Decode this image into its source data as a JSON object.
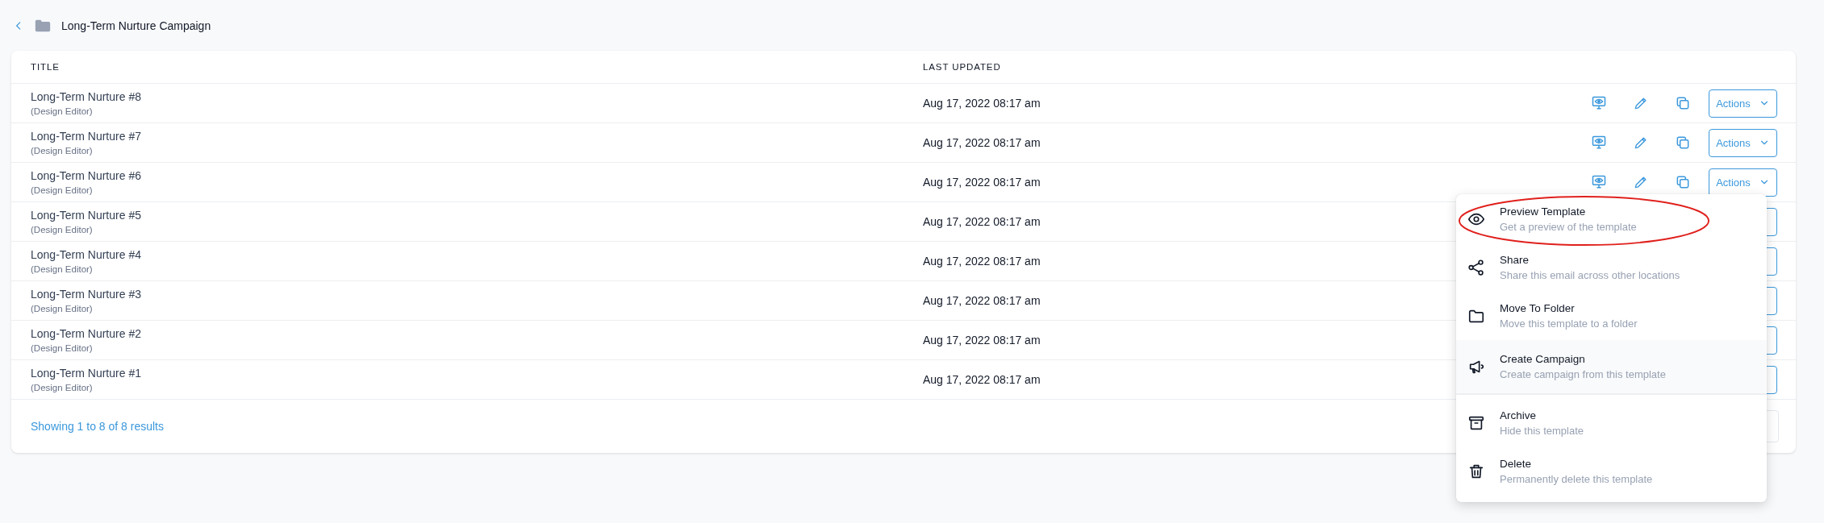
{
  "breadcrumb": {
    "title": "Long-Term Nurture Campaign"
  },
  "table": {
    "columns": [
      "TITLE",
      "LAST UPDATED"
    ],
    "rows": [
      {
        "title": "Long-Term Nurture #8",
        "subtitle": "(Design Editor)",
        "updated": "Aug 17, 2022 08:17 am",
        "actions_label": "Actions",
        "menu_open": false
      },
      {
        "title": "Long-Term Nurture #7",
        "subtitle": "(Design Editor)",
        "updated": "Aug 17, 2022 08:17 am",
        "actions_label": "Actions",
        "menu_open": false
      },
      {
        "title": "Long-Term Nurture #6",
        "subtitle": "(Design Editor)",
        "updated": "Aug 17, 2022 08:17 am",
        "actions_label": "Actions",
        "menu_open": true
      },
      {
        "title": "Long-Term Nurture #5",
        "subtitle": "(Design Editor)",
        "updated": "Aug 17, 2022 08:17 am",
        "menu_open": false
      },
      {
        "title": "Long-Term Nurture #4",
        "subtitle": "(Design Editor)",
        "updated": "Aug 17, 2022 08:17 am",
        "menu_open": false
      },
      {
        "title": "Long-Term Nurture #3",
        "subtitle": "(Design Editor)",
        "updated": "Aug 17, 2022 08:17 am",
        "menu_open": false
      },
      {
        "title": "Long-Term Nurture #2",
        "subtitle": "(Design Editor)",
        "updated": "Aug 17, 2022 08:17 am",
        "menu_open": false
      },
      {
        "title": "Long-Term Nurture #1",
        "subtitle": "(Design Editor)",
        "updated": "Aug 17, 2022 08:17 am",
        "menu_open": false
      }
    ],
    "footer": "Showing 1 to 8 of 8 results"
  },
  "actions_menu": {
    "items": [
      {
        "kind": "eye",
        "label": "Preview Template",
        "description": "Get a preview of the template",
        "hovered": false,
        "circled": true
      },
      {
        "kind": "share",
        "label": "Share",
        "description": "Share this email across other locations",
        "hovered": false,
        "circled": false
      },
      {
        "kind": "folder",
        "label": "Move To Folder",
        "description": "Move this template to a folder",
        "hovered": false,
        "circled": false
      },
      {
        "kind": "megaphone",
        "label": "Create Campaign",
        "description": "Create campaign from this template",
        "hovered": true,
        "circled": false,
        "divider_after": true
      },
      {
        "kind": "archive",
        "label": "Archive",
        "description": "Hide this template",
        "hovered": false,
        "circled": false
      },
      {
        "kind": "trash",
        "label": "Delete",
        "description": "Permanently delete this template",
        "hovered": false,
        "circled": false
      }
    ]
  }
}
